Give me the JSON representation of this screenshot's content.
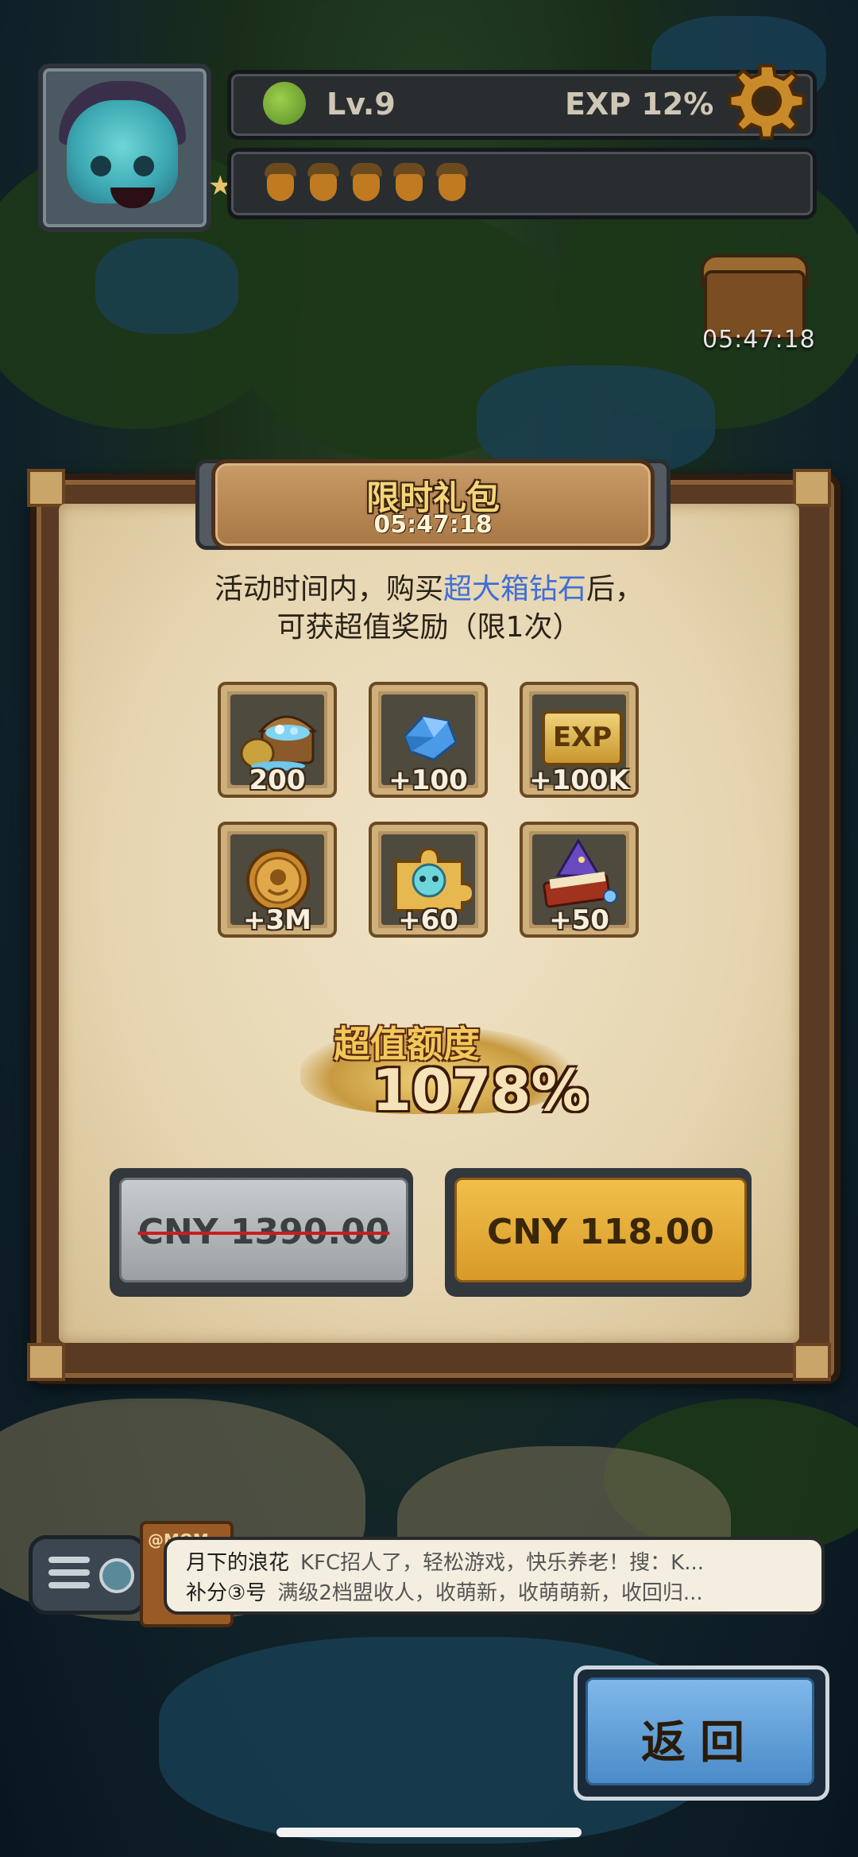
{
  "hud": {
    "level": "Lv.9",
    "exp": "EXP 12%",
    "acorn_count": 5,
    "chest_timer": "05:47:18"
  },
  "panel": {
    "title": "限时礼包",
    "timer": "05:47:18",
    "desc_part1": "活动时间内，购买",
    "desc_highlight": "超大箱钻石",
    "desc_part2": "后，",
    "desc_line2": "可获超值奖励（限1次）",
    "rewards": [
      {
        "icon": "treasure-chest-icon",
        "amount": "200"
      },
      {
        "icon": "diamond-icon",
        "amount": "+100"
      },
      {
        "icon": "exp-badge-icon",
        "amount": "+100K",
        "icon_text": "EXP"
      },
      {
        "icon": "gold-coin-icon",
        "amount": "+3M"
      },
      {
        "icon": "puzzle-piece-icon",
        "amount": "+60"
      },
      {
        "icon": "wizard-book-icon",
        "amount": "+50"
      }
    ],
    "value_label": "超值额度",
    "value_percent": "1078%",
    "original_price": "CNY 1390.00",
    "sale_price": "CNY 118.00"
  },
  "chat": {
    "sign_text": "@MOM",
    "messages": [
      {
        "user": "月下的浪花",
        "text": "KFC招人了，轻松游戏，快乐养老！搜：K..."
      },
      {
        "user": "补分③号",
        "text": "满级2档盟收人，收萌新，收萌萌新，收回归..."
      }
    ]
  },
  "back_button": "返回",
  "colors": {
    "highlight": "#3f6fd6",
    "sale_button": "#e8ad38",
    "strike": "#c81e1e"
  }
}
